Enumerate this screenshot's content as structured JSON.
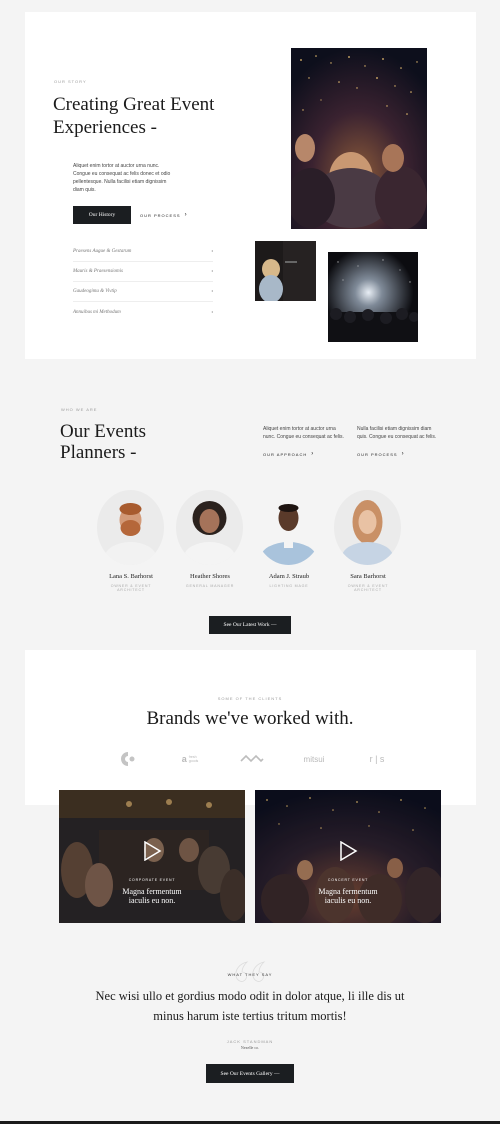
{
  "story": {
    "eyebrow": "OUR STORY",
    "title_line1": "Creating Great Event",
    "title_line2": "Experiences -",
    "body": "Aliquet enim tortor at auctor urna nunc. Congue eu consequat ac felis donec et odio pellentesque. Nulla facilisi etiam dignissim diam quis.",
    "primary_button": "Our History",
    "secondary_link": "OUR PROCESS",
    "list": [
      {
        "label": "Praesens Augue & Gestarum"
      },
      {
        "label": "Mauris & Praesensiomis"
      },
      {
        "label": "Gaudeogimu & Vivtip"
      },
      {
        "label": "Annuibus mi Methodum"
      }
    ]
  },
  "planners": {
    "eyebrow": "WHO WE ARE",
    "title_line1": "Our Events",
    "title_line2": "Planners -",
    "col1_text": "Aliquet enim tortor at auctor urna nunc. Congue eu consequat ac felis.",
    "col1_link": "OUR APPROACH",
    "col2_text": "Nulla facilisi etiam dignissim diam quis. Congue eu consequat ac felis.",
    "col2_link": "OUR PROCESS",
    "people": [
      {
        "name": "Lana S. Barhorst",
        "role": "OWNER & EVENT ARCHITECT"
      },
      {
        "name": "Heather Shores",
        "role": "GENERAL MANAGER"
      },
      {
        "name": "Adam J. Straub",
        "role": "LIGHTING MAGE"
      },
      {
        "name": "Sara Barhorst",
        "role": "OWNER & EVENT ARCHITECT"
      }
    ],
    "button": "See Our Latest Work —"
  },
  "brands": {
    "eyebrow": "SOME OF THE CLIENTS",
    "title": "Brands we've worked with.",
    "logos": [
      "C",
      "a fresh goods",
      "waves-logo",
      "mitsui",
      "r|s"
    ],
    "logo_texts": {
      "fresh": "fresh",
      "goods": "goods",
      "mitsui": "mitsui",
      "rs": "r | s"
    }
  },
  "videos": [
    {
      "eyebrow": "CORPORATE EVENT",
      "title_line1": "Magna fermentum",
      "title_line2": "iaculis eu non."
    },
    {
      "eyebrow": "CONCERT EVENT",
      "title_line1": "Magna fermentum",
      "title_line2": "iaculis eu non."
    }
  ],
  "testimonial": {
    "eyebrow": "WHAT THEY SAY",
    "quote_line1": "Nec wisi ullo et gordius modo odit in dolor atque, li ille dis ut",
    "quote_line2": "minus harum iste tertius tritum mortis!",
    "author": "JACK STANDMAN",
    "author_role": "Nexelle co.",
    "button": "See Our Events Gallery —"
  },
  "colors": {
    "dark": "#1b1e21",
    "bg": "#f4f4f4",
    "card": "#ffffff"
  }
}
